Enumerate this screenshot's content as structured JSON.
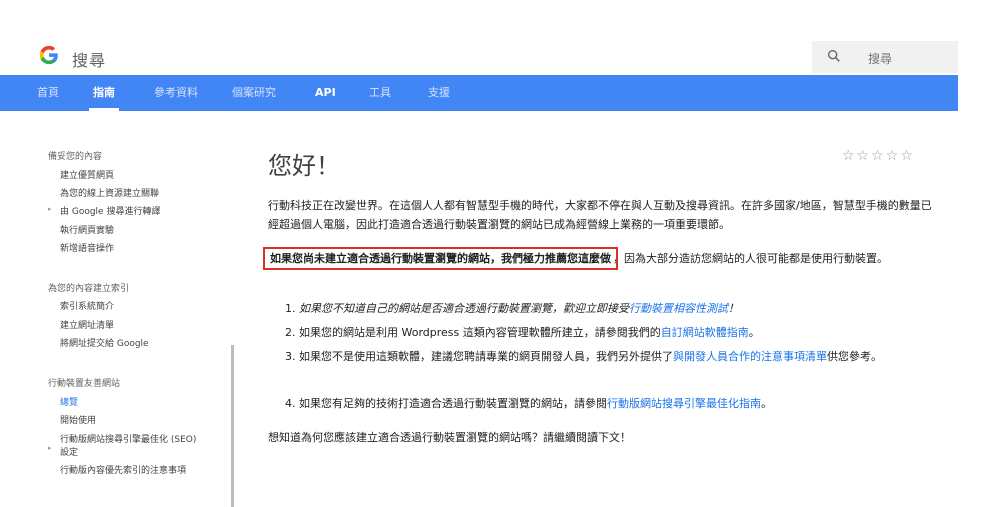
{
  "header": {
    "site_name": "搜尋",
    "search_placeholder": "搜尋"
  },
  "nav": {
    "tabs": [
      "首頁",
      "指南",
      "參考資料",
      "個案研究",
      "API",
      "工具",
      "支援"
    ],
    "active_index": 1
  },
  "sidebar": {
    "items": [
      {
        "label": "備妥您的內容",
        "type": "heading"
      },
      {
        "label": "建立優質網頁",
        "type": "item"
      },
      {
        "label": "為您的線上資源建立關聯",
        "type": "item"
      },
      {
        "label": "由 Google 搜尋進行轉譯",
        "type": "expandable"
      },
      {
        "label": "執行網頁實驗",
        "type": "item"
      },
      {
        "label": "新增語音操作",
        "type": "item"
      },
      {
        "label": "為您的內容建立索引",
        "type": "heading"
      },
      {
        "label": "索引系統簡介",
        "type": "item"
      },
      {
        "label": "建立網址清單",
        "type": "item"
      },
      {
        "label": "將網址提交給 Google",
        "type": "item"
      },
      {
        "label": "行動裝置友善網站",
        "type": "heading"
      },
      {
        "label": "總覽",
        "type": "active"
      },
      {
        "label": "開始使用",
        "type": "item"
      },
      {
        "label": "行動版網站搜尋引擎最佳化 (SEO)",
        "type": "expandable"
      },
      {
        "label": "設定",
        "type": "item"
      },
      {
        "label": "行動版內容優先索引的注意事項",
        "type": "item"
      }
    ]
  },
  "main": {
    "title": "您好！",
    "stars": "☆☆☆☆☆",
    "para1": "行動科技正在改變世界。在這個人人都有智慧型手機的時代，大家都不停在與人互動及搜尋資訊。在許多國家/地區，智慧型手機的數量已經超過個人電腦，因此打造適合透過行動裝置瀏覽的網站已成為經營線上業務的一項重要環節。",
    "para2_bold": "如果您尚未建立適合透過行動裝置瀏覽的網站，我們極力推薦您這麼做",
    "para2_rest": "，因為大部分造訪您網站的人很可能都是使用行動裝置。",
    "list": [
      {
        "num": "1.",
        "text": "如果您不知道自己的網站是否適合透過行動裝置瀏覽，歡迎立即接受",
        "link": "行動裝置相容性測試",
        "after": "！"
      },
      {
        "num": "2.",
        "text": "如果您的網站是利用 Wordpress 這類內容管理軟體所建立，請參閱我們的",
        "link": "自訂網站軟體指南",
        "after": "。"
      },
      {
        "num": "3.",
        "text": "如果您不是使用這類軟體，建議您聘請專業的網頁開發人員，我們另外提供了",
        "link": "與開發人員合作的注意事項清單",
        "after": "供您參考。"
      },
      {
        "num": "4.",
        "text": "如果您有足夠的技術打造適合透過行動裝置瀏覽的網站，請參閱",
        "link": "行動版網站搜尋引擎最佳化指南",
        "after": "。"
      }
    ],
    "para3": "想知道為何您應該建立適合透過行動裝置瀏覽的網站嗎？請繼續閱讀下文！"
  },
  "colors": {
    "nav_blue": "#4285f4",
    "link_blue": "#1a73e8",
    "highlight_red": "#d93025"
  }
}
